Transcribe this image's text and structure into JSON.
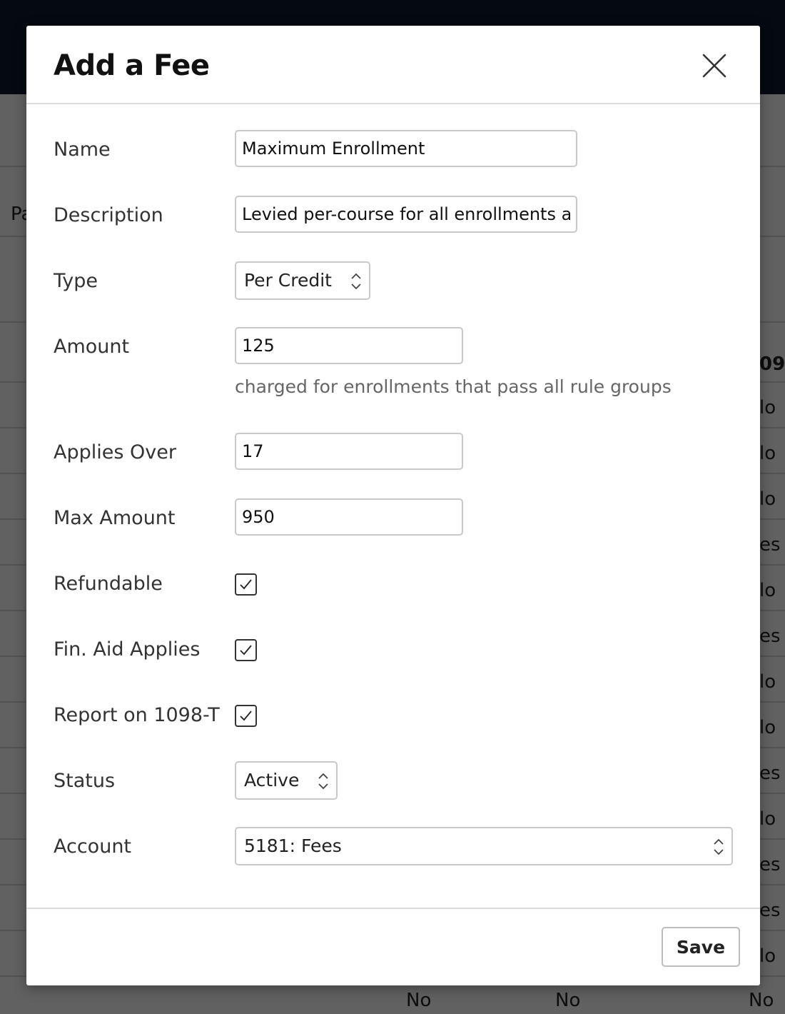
{
  "background": {
    "column_fragment_left": "Pa",
    "column_fragment_header": "09",
    "right_column_cells": [
      "lo",
      "lo",
      "lo",
      "es",
      "lo",
      "es",
      "lo",
      "lo",
      "es",
      "lo",
      "es",
      "es",
      "lo"
    ],
    "bottom_row": [
      "No",
      "No",
      "No"
    ]
  },
  "modal": {
    "title": "Add a Fee",
    "close_label": "×",
    "fields": {
      "name": {
        "label": "Name",
        "value": "Maximum Enrollment"
      },
      "description": {
        "label": "Description",
        "value": "Levied per-course for all enrollments above the maximum"
      },
      "type": {
        "label": "Type",
        "value": "Per Credit"
      },
      "amount": {
        "label": "Amount",
        "value": "125",
        "help": "charged for enrollments that pass all rule groups"
      },
      "applies_over": {
        "label": "Applies Over",
        "value": "17"
      },
      "max_amount": {
        "label": "Max Amount",
        "value": "950"
      },
      "refundable": {
        "label": "Refundable",
        "checked": true
      },
      "fin_aid_applies": {
        "label": "Fin. Aid Applies",
        "checked": true
      },
      "report_1098t": {
        "label": "Report on 1098-T",
        "checked": true
      },
      "status": {
        "label": "Status",
        "value": "Active"
      },
      "account": {
        "label": "Account",
        "value": "5181: Fees"
      }
    },
    "save_label": "Save"
  },
  "colors": {
    "topbar": "#0f1a2b",
    "overlay": "rgba(0,0,0,0.62)",
    "modal_bg": "#ffffff",
    "label_text": "#333333",
    "help_text": "#666666",
    "input_border": "#c9c9c9"
  }
}
